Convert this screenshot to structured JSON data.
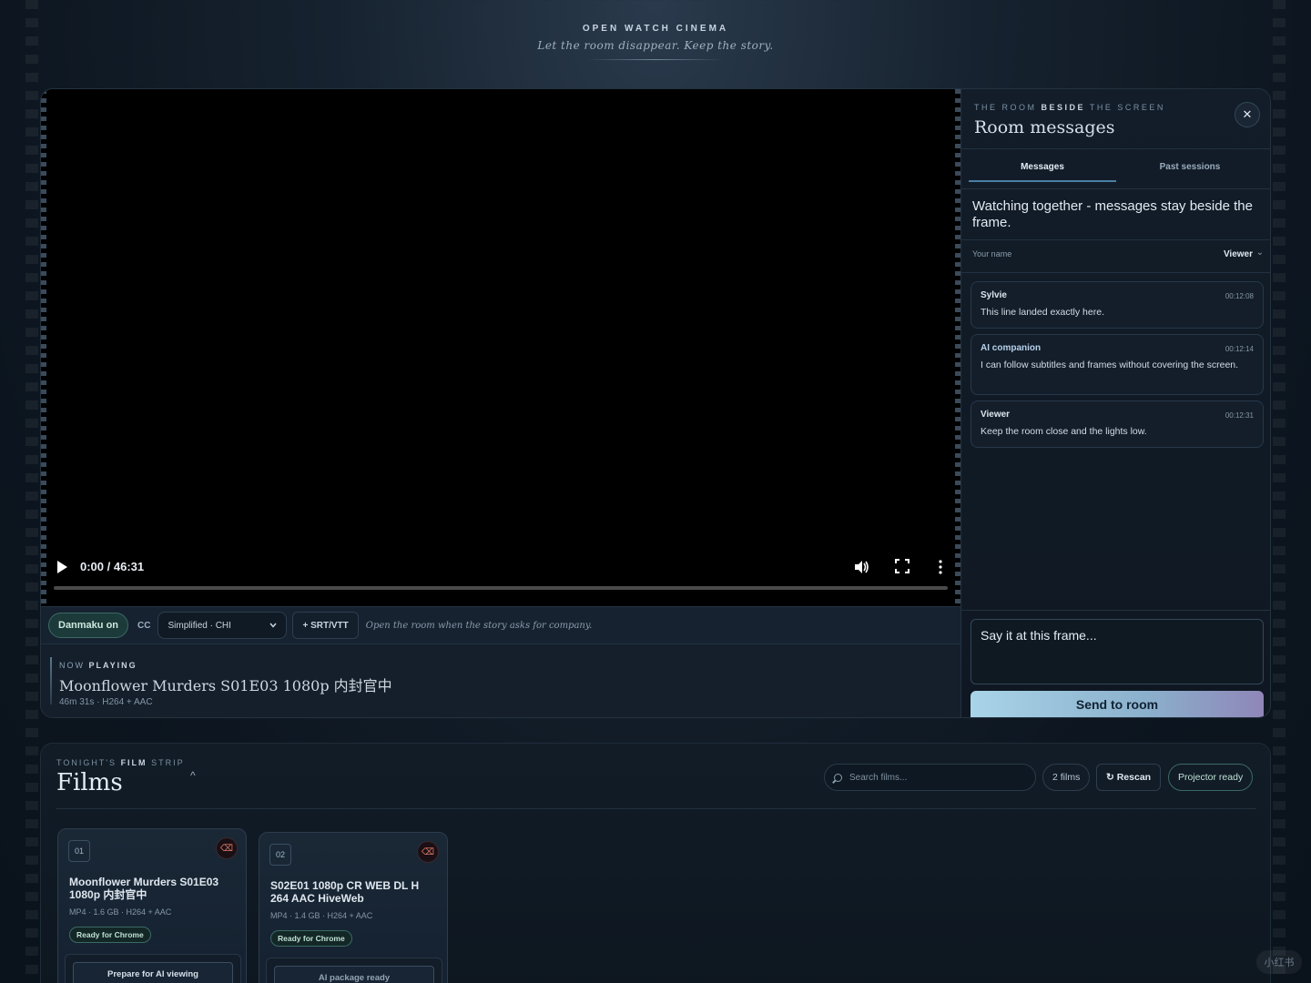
{
  "brand": {
    "title": "OPEN WATCH CINEMA",
    "tagline": "Let the room disappear. Keep the story."
  },
  "player": {
    "time": "0:00 / 46:31",
    "progress": 0
  },
  "toolbar": {
    "danmaku": "Danmaku on",
    "cc_label": "CC",
    "subtitle_selected": "Simplified · CHI",
    "srt_button": "+ SRT/VTT",
    "hint": "Open the room when the story asks for company."
  },
  "now_playing": {
    "kicker_1": "NOW ",
    "kicker_2": "PLAYING",
    "title": "Moonflower Murders S01E03 1080p 内封官中",
    "meta": "46m 31s · H264 + AAC"
  },
  "panel": {
    "kicker_1": "THE ROOM ",
    "kicker_2": "BESIDE",
    "kicker_3": " THE SCREEN",
    "title": "Room messages",
    "close": "✕",
    "tabs": [
      "Messages",
      "Past sessions"
    ],
    "intro": "Watching together - messages stay beside the frame.",
    "name_label": "Your name",
    "name_value": "Viewer",
    "messages": [
      {
        "author": "Sylvie",
        "time": "00:12:08",
        "text": "This line landed exactly here."
      },
      {
        "author": "AI companion",
        "time": "00:12:14",
        "text": "I can follow subtitles and frames without covering the screen."
      },
      {
        "author": "Viewer",
        "time": "00:12:31",
        "text": "Keep the room close and the lights low."
      }
    ],
    "composer_placeholder": "Say it at this frame...",
    "send": "Send to room"
  },
  "films": {
    "kicker_1": "TONIGHT'S ",
    "kicker_2": "FILM",
    "kicker_3": " STRIP",
    "title": "Films",
    "caret": "^",
    "search_placeholder": "Search films...",
    "count": "2 films",
    "rescan": "↻ Rescan",
    "status": "Projector ready",
    "cards": [
      {
        "num": "01",
        "title": "Moonflower Murders S01E03 1080p 内封官中",
        "meta": "MP4 · 1.6 GB · H264 + AAC",
        "badge": "Ready for Chrome",
        "action": "Prepare for AI viewing"
      },
      {
        "num": "02",
        "title": "S02E01 1080p CR WEB DL H 264 AAC HiveWeb",
        "meta": "MP4 · 1.4 GB · H264 + AAC",
        "badge": "Ready for Chrome",
        "action": "AI package ready"
      }
    ]
  },
  "watermark": "小红书",
  "colors": {
    "accent": "#4a7ea4",
    "ready": "#3b6a64",
    "send_gradient_start": "#a9d4e8",
    "send_gradient_end": "#8f86b8",
    "delete": "#e07a6a"
  }
}
